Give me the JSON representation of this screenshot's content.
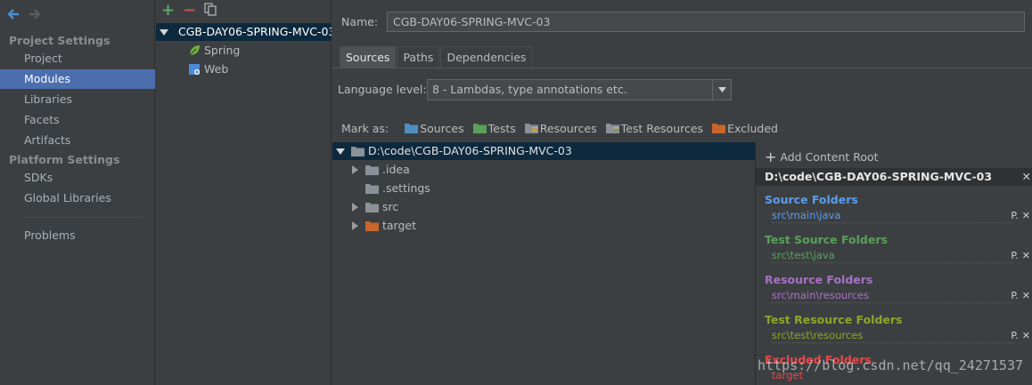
{
  "nav": {
    "project_settings": "Project Settings",
    "project_items": [
      "Project",
      "Modules",
      "Libraries",
      "Facets",
      "Artifacts"
    ],
    "platform_settings": "Platform Settings",
    "platform_items": [
      "SDKs",
      "Global Libraries"
    ],
    "problems": "Problems",
    "selected": "Modules"
  },
  "modules": {
    "root": "CGB-DAY06-SPRING-MVC-03",
    "children": [
      "Spring",
      "Web"
    ]
  },
  "module_detail": {
    "name_label": "Name:",
    "name_value": "CGB-DAY06-SPRING-MVC-03",
    "tabs": [
      "Sources",
      "Paths",
      "Dependencies"
    ],
    "active_tab": "Sources",
    "language_level_label": "Language level:",
    "language_level_value": "8 - Lambdas, type annotations etc.",
    "mark_as_label": "Mark as:",
    "mark_as": [
      "Sources",
      "Tests",
      "Resources",
      "Test Resources",
      "Excluded"
    ]
  },
  "content_tree": {
    "root": "D:\\code\\CGB-DAY06-SPRING-MVC-03",
    "children": [
      ".idea",
      ".settings",
      "src",
      "target"
    ]
  },
  "content_root": {
    "add_label": "Add Content Root",
    "path": "D:\\code\\CGB-DAY06-SPRING-MVC-03",
    "groups": [
      {
        "title": "Source Folders",
        "path": "src\\main\\java"
      },
      {
        "title": "Test Source Folders",
        "path": "src\\test\\java"
      },
      {
        "title": "Resource Folders",
        "path": "src\\main\\resources"
      },
      {
        "title": "Test Resource Folders",
        "path": "src\\test\\resources"
      },
      {
        "title": "Excluded Folders",
        "path": "target"
      }
    ]
  },
  "watermark": "https://blog.csdn.net/qq_24271537",
  "colors": {
    "selection": "#4b6eaf",
    "tree_selection": "#0d293e",
    "source": "#5c9ded",
    "test": "#5aa05a",
    "resource": "#a772c4",
    "test_resource": "#8ea62a",
    "excluded": "#e84a4a",
    "add": "#59a869",
    "remove": "#c75450"
  },
  "icons": {
    "back": "arrow-left-icon",
    "forward": "arrow-right-icon",
    "add": "plus-icon",
    "remove": "minus-icon",
    "copy": "copy-icon",
    "spring": "spring-leaf-icon",
    "web": "web-icon",
    "folder": "folder-icon",
    "dropdown": "chevron-down-icon",
    "close": "close-icon",
    "edit": "edit-properties-icon"
  }
}
